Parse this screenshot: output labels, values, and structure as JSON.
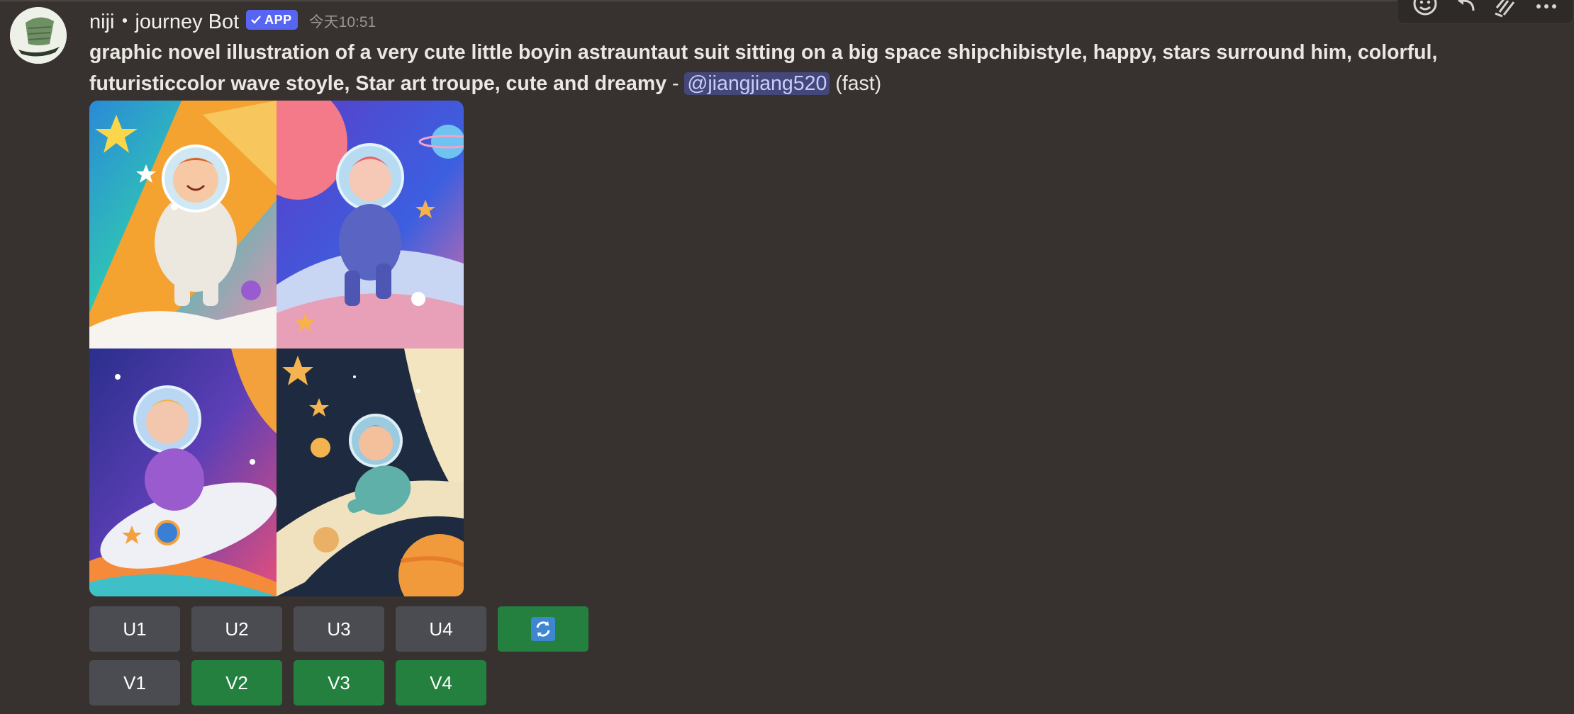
{
  "message": {
    "username": "niji・journey Bot",
    "badge": "APP",
    "timestamp": "今天10:51",
    "prompt": "graphic novel illustration of a very cute little boyin astrauntaut suit sitting on a big space shipchibistyle, happy, stars surround him, colorful, futuristiccolor wave stoyle, Star art troupe, cute and dreamy",
    "separator": " - ",
    "mention": "@jiangjiang520",
    "speed": " (fast)"
  },
  "toolbar": {
    "icons": [
      "add-reaction-icon",
      "reply-icon",
      "apps-icon",
      "more-icon"
    ]
  },
  "image_grid": {
    "tiles": [
      "tile-1",
      "tile-2",
      "tile-3",
      "tile-4"
    ]
  },
  "buttons": {
    "upscale": [
      "U1",
      "U2",
      "U3",
      "U4"
    ],
    "variation": [
      "V1",
      "V2",
      "V3",
      "V4"
    ],
    "reroll_icon": "reroll-icon"
  },
  "colors": {
    "background": "#37322f",
    "badge": "#5865f2",
    "button_gray": "#4b4c52",
    "button_green": "#23803f",
    "mention_bg": "#44477a"
  }
}
